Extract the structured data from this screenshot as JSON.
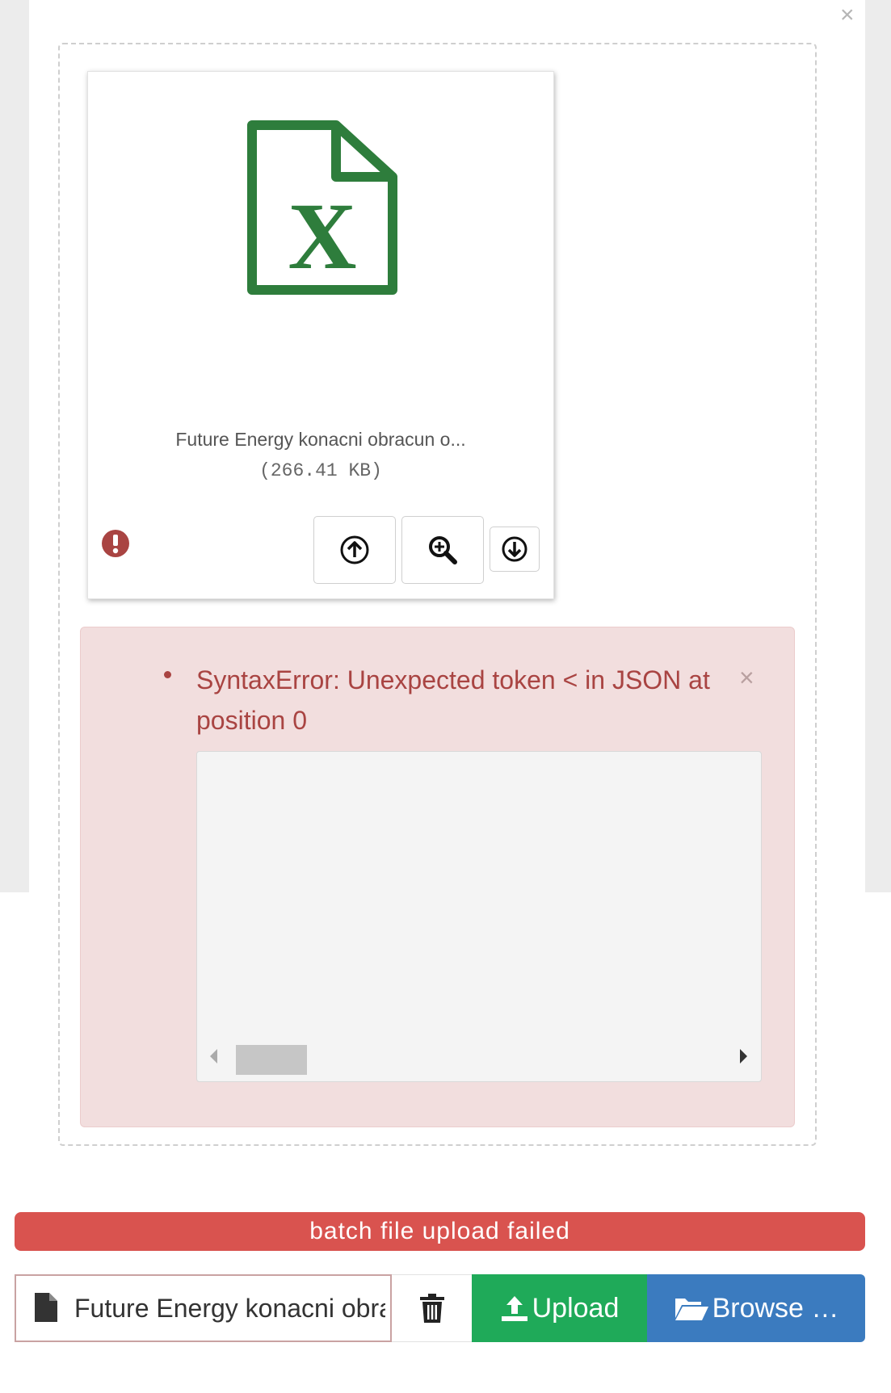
{
  "dialog": {
    "close_label": "×"
  },
  "preview": {
    "file_type_icon": "excel-file-icon",
    "file_caption": "Future Energy konacni obracun o...",
    "file_size": "(266.41 KB)",
    "status_icon": "exclamation-circle-icon",
    "actions": [
      "upload-icon",
      "zoom-icon",
      "download-icon"
    ]
  },
  "error_alert": {
    "message": "SyntaxError: Unexpected token < in JSON at position 0",
    "close_label": "×"
  },
  "progress": {
    "label": "batch file upload failed",
    "percent": 100,
    "color": "#d9534f"
  },
  "file_input": {
    "caption": "Future Energy konacni obracun o",
    "remove_icon": "trash-icon",
    "upload_label": "Upload",
    "browse_label": "Browse …"
  },
  "colors": {
    "excel_green": "#2e7d3c",
    "error_text": "#a94442",
    "upload_green": "#1faa59",
    "browse_blue": "#3b7bbf"
  }
}
